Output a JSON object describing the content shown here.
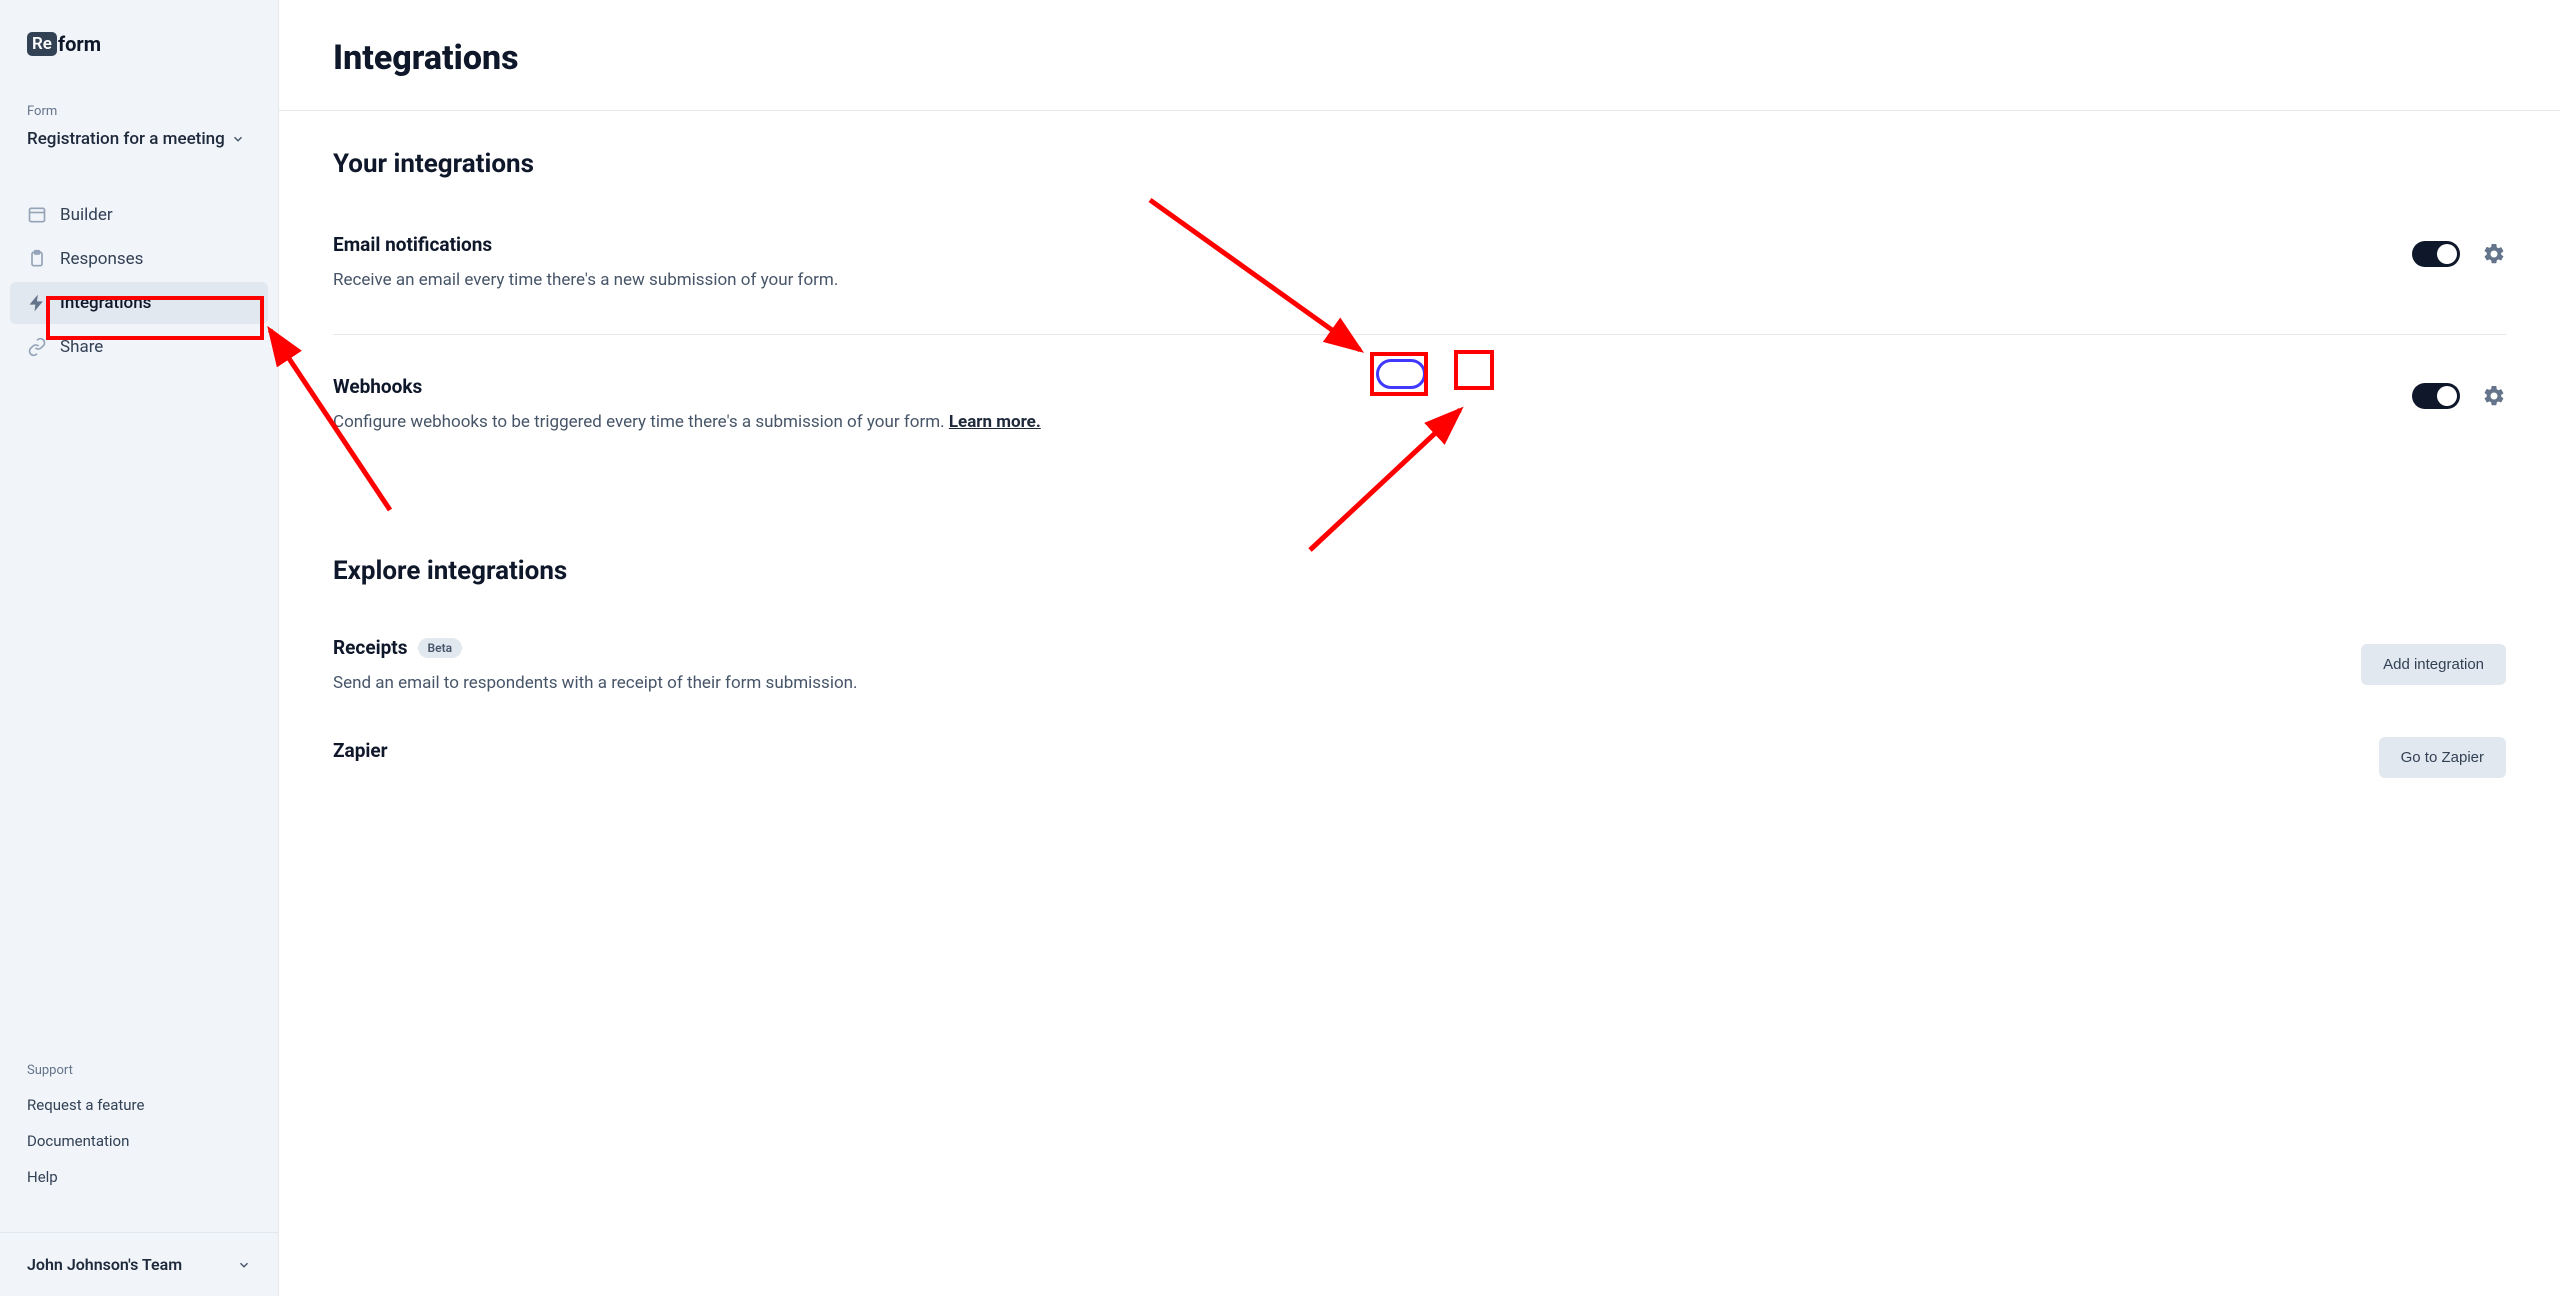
{
  "logo": {
    "prefix": "Re",
    "suffix": "form"
  },
  "sidebar": {
    "section_label": "Form",
    "form_name": "Registration for a meeting",
    "nav": [
      {
        "label": "Builder"
      },
      {
        "label": "Responses"
      },
      {
        "label": "Integrations"
      },
      {
        "label": "Share"
      }
    ],
    "support_label": "Support",
    "support_links": [
      "Request a feature",
      "Documentation",
      "Help"
    ],
    "team": "John Johnson's Team"
  },
  "page": {
    "title": "Integrations",
    "your_integrations_title": "Your integrations",
    "explore_title": "Explore integrations"
  },
  "integrations": {
    "email": {
      "title": "Email notifications",
      "desc": "Receive an email every time there's a new submission of your form."
    },
    "webhooks": {
      "title": "Webhooks",
      "desc": "Configure webhooks to be triggered every time there's a submission of your form. ",
      "learn_more": "Learn more."
    }
  },
  "explore": {
    "receipts": {
      "title": "Receipts",
      "badge": "Beta",
      "desc": "Send an email to respondents with a receipt of their form submission.",
      "button": "Add integration"
    },
    "zapier": {
      "title": "Zapier",
      "button": "Go to Zapier"
    }
  }
}
